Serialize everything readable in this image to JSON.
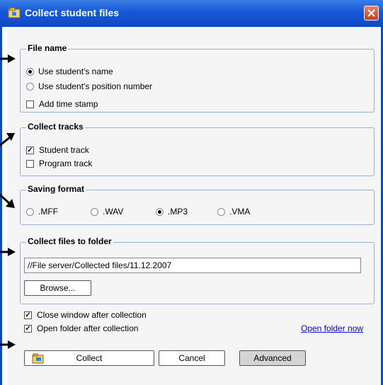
{
  "window": {
    "title": "Collect student files"
  },
  "file_name": {
    "legend": "File name",
    "options": [
      "Use student's name",
      "Use student's position number"
    ],
    "selected": 0,
    "timestamp_label": "Add time stamp",
    "timestamp_checked": false
  },
  "collect_tracks": {
    "legend": "Collect tracks",
    "student_label": "Student track",
    "student_checked": true,
    "program_label": "Program track",
    "program_checked": false
  },
  "saving_format": {
    "legend": "Saving format",
    "formats": [
      ".MFF",
      ".WAV",
      ".MP3",
      ".VMA"
    ],
    "selected": 2
  },
  "collect_folder": {
    "legend": "Collect files to folder",
    "path": "//File server/Collected files/11.12.2007",
    "browse_label": "Browse..."
  },
  "options": {
    "close_after_label": "Close window after collection",
    "close_after_checked": true,
    "open_folder_label": "Open folder after collection",
    "open_folder_checked": true,
    "open_folder_now_link": "Open folder now"
  },
  "buttons": {
    "collect": "Collect",
    "cancel": "Cancel",
    "advanced": "Advanced"
  },
  "colors": {
    "title_bar": "#1557d8",
    "close": "#c43c1b",
    "panel": "#f5f5f5",
    "link": "#0000ee"
  }
}
